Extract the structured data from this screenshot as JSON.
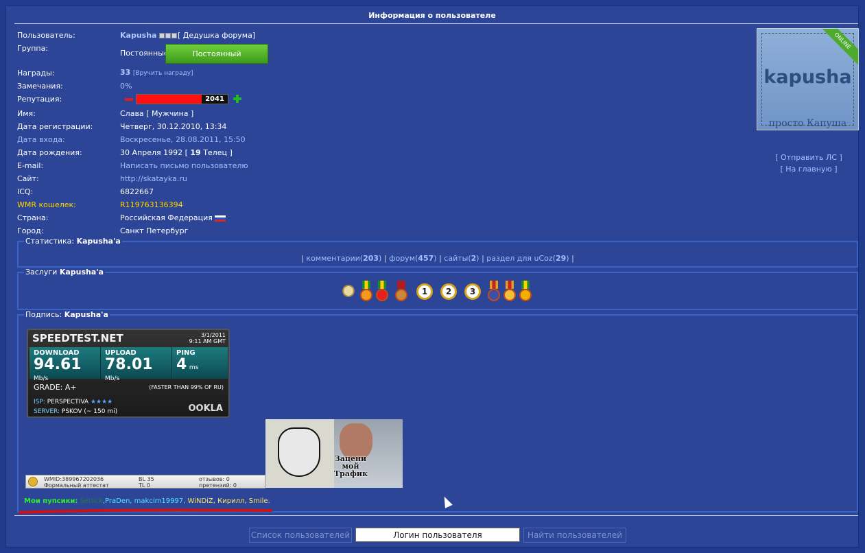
{
  "header": {
    "title": "Информация о пользователе"
  },
  "profile": {
    "user_label": "Пользователь:",
    "username": "Kapusha",
    "rank_title": "[ Дедушка форума]",
    "group_label": "Группа:",
    "group_name": "Постоянные",
    "group_badge": "Постоянный",
    "awards_label": "Награды:",
    "awards_count": "33",
    "awards_give": "[Вручить награду]",
    "warnings_label": "Замечания:",
    "warnings_value": "0%",
    "rep_label": "Репутация:",
    "rep_value": "2041",
    "rep_fill_fraction": 0.72,
    "name_label": "Имя:",
    "name_value": "Слава [ Мужчина ]",
    "reg_label": "Дата регистрации:",
    "reg_value": "Четверг, 30.12.2010, 13:34",
    "login_label": "Дата входа:",
    "login_value": "Воскресенье, 28.08.2011, 15:50",
    "birth_label": "Дата рождения:",
    "birth_value_a": "30 Апреля 1992 [ ",
    "birth_age": "19",
    "birth_value_b": " Телец ]",
    "email_label": "E-mail:",
    "email_value": "Написать письмо пользователю",
    "site_label": "Сайт:",
    "site_value": "http://skatayka.ru",
    "icq_label": "ICQ:",
    "icq_value": "6822667",
    "wmr_label": "WMR кошелек:",
    "wmr_value": "R119763136394",
    "country_label": "Страна:",
    "country_value": "Российская Федерация",
    "city_label": "Город:",
    "city_value": "Санкт Петербург"
  },
  "avatar": {
    "name": "kapusha",
    "subtitle": "просто Капуша",
    "ribbon": "ONLINE"
  },
  "side_links": {
    "send_pm": "[ Отправить ЛС ]",
    "home": "[ На главную ]"
  },
  "stats": {
    "legend_prefix": "Статистика:",
    "legend_user": "Kapusha'a",
    "comments_label": "комментарии",
    "comments_count": "203",
    "forum_label": "форум",
    "forum_count": "457",
    "sites_label": "сайты",
    "sites_count": "2",
    "ucoz_label": "раздел для uCoz",
    "ucoz_count": "29"
  },
  "merits": {
    "legend_prefix": "Заслуги",
    "legend_user": "Kapusha'a",
    "medal_1": "1",
    "medal_2": "2",
    "medal_3": "3"
  },
  "signature": {
    "legend_prefix": "Подпись:",
    "legend_user": "Kapusha'a",
    "speedtest": {
      "logo": "SPEEDTEST.NET",
      "date": "3/1/2011",
      "time": "9:11 AM GMT",
      "download_label": "DOWNLOAD",
      "download_value": "94.61",
      "download_unit": "Mb/s",
      "upload_label": "UPLOAD",
      "upload_value": "78.01",
      "upload_unit": "Mb/s",
      "ping_label": "PING",
      "ping_value": "4",
      "ping_unit": "ms",
      "grade": "GRADE: A+",
      "faster": "(FASTER THAN 99% OF RU)",
      "isp_label": "ISP:",
      "isp_value": "PERSPECTIVA",
      "server_label": "SERVER:",
      "server_value": "PSKOV (~ 150 mi)",
      "brand": "OOKLA"
    },
    "picture_caption": "Зацени мой Трафик",
    "wmid": {
      "wmid": "WMID:389967202036",
      "attest": "Формальный аттестат",
      "bl": "BL 35",
      "tl": "TL 0",
      "reviews": "отзывов: 0",
      "claims": "претензий: 0"
    },
    "pupils_label": "Мои пупсики:",
    "pupil_hidden": "Setlick",
    "pupils_cyan": ",PraDen, makcim19997,",
    "pupils_yellow": " WiNDiZ, Кирилл, Smile."
  },
  "footer": {
    "list_users": "Список пользователей",
    "login_placeholder": "Логин пользователя",
    "find_users": "Найти пользователей"
  }
}
